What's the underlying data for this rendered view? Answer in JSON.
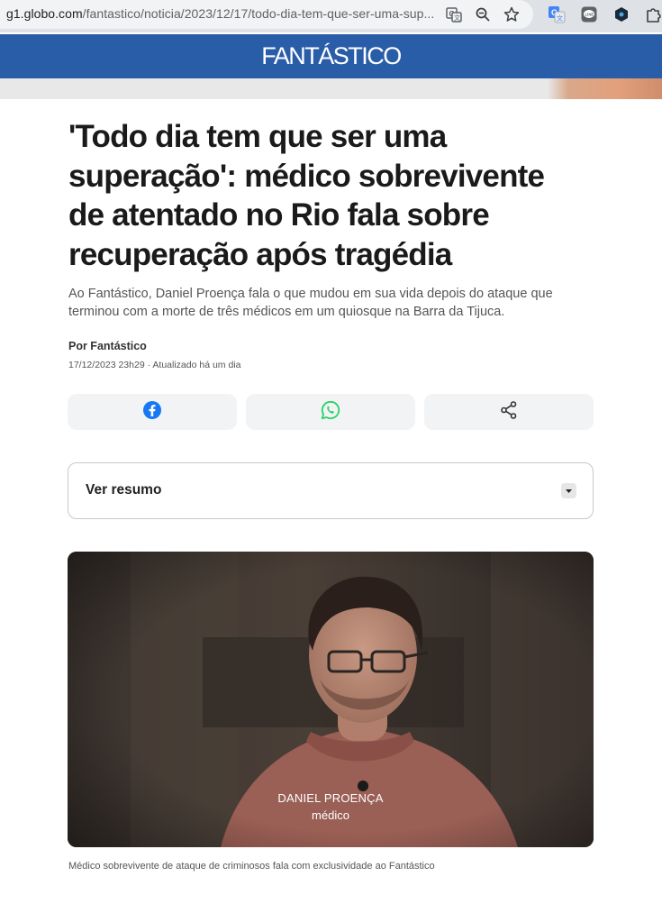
{
  "browser": {
    "url_host": "g1.globo.com",
    "url_path": "/fantastico/noticia/2023/12/17/todo-dia-tem-que-ser-uma-sup...",
    "icons": [
      "translate-icon",
      "zoom-icon",
      "bookmark-star-icon",
      "google-translate-extension-icon",
      "line-extension-icon",
      "hexagon-extension-icon",
      "puzzle-extension-icon"
    ]
  },
  "site": {
    "brand": "FANTÁSTICO",
    "header_color": "#2a5da8"
  },
  "article": {
    "headline": "'Todo dia tem que ser uma superação': médico sobrevivente de atentado no Rio fala sobre recuperação após tragédia",
    "subtitle": "Ao Fantástico, Daniel Proença fala o que mudou em sua vida depois do ataque que terminou com a morte de três médicos em um quiosque na Barra da Tijuca.",
    "byline": "Por Fantástico",
    "dateline": "17/12/2023 23h29 · Atualizado há um dia"
  },
  "share": {
    "buttons": [
      {
        "icon": "facebook-icon",
        "color": "#1877f2"
      },
      {
        "icon": "whatsapp-icon",
        "color": "#25d366"
      },
      {
        "icon": "share-icon",
        "color": "#333333"
      }
    ]
  },
  "summary": {
    "label": "Ver resumo"
  },
  "photo": {
    "overlay_name": "DANIEL PROENÇA",
    "overlay_role": "médico",
    "caption": "Médico sobrevivente de ataque de criminosos fala com exclusividade ao Fantástico"
  }
}
